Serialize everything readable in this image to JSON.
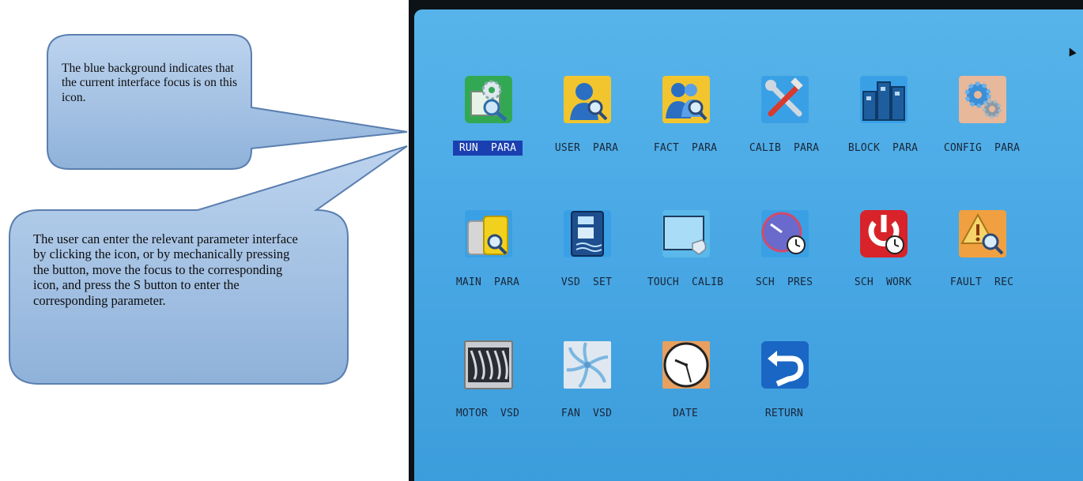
{
  "callouts": [
    {
      "text": "The blue background indicates that the current interface focus is on this icon."
    },
    {
      "text": "The user can enter the relevant parameter interface by clicking the icon, or by mechanically pressing the button, move the focus to the corresponding icon, and press the S button to enter the corresponding parameter."
    }
  ],
  "menu": {
    "focused": "RUN  PARA",
    "rows": [
      [
        {
          "label": "RUN  PARA",
          "icon": "run-para-icon"
        },
        {
          "label": "USER  PARA",
          "icon": "user-para-icon"
        },
        {
          "label": "FACT  PARA",
          "icon": "fact-para-icon"
        },
        {
          "label": "CALIB  PARA",
          "icon": "calib-para-icon"
        },
        {
          "label": "BLOCK  PARA",
          "icon": "block-para-icon"
        },
        {
          "label": "CONFIG  PARA",
          "icon": "config-para-icon"
        }
      ],
      [
        {
          "label": "MAIN  PARA",
          "icon": "main-para-icon"
        },
        {
          "label": "VSD  SET",
          "icon": "vsd-set-icon"
        },
        {
          "label": "TOUCH  CALIB",
          "icon": "touch-calib-icon"
        },
        {
          "label": "SCH  PRES",
          "icon": "sch-pres-icon"
        },
        {
          "label": "SCH  WORK",
          "icon": "sch-work-icon"
        },
        {
          "label": "FAULT  REC",
          "icon": "fault-rec-icon"
        }
      ],
      [
        {
          "label": "MOTOR  VSD",
          "icon": "motor-vsd-icon"
        },
        {
          "label": "FAN  VSD",
          "icon": "fan-vsd-icon"
        },
        {
          "label": "DATE",
          "icon": "date-icon"
        },
        {
          "label": "RETURN",
          "icon": "return-icon"
        }
      ]
    ]
  },
  "colors": {
    "screen_bg": "#4aa9e5",
    "focus_bg": "#1a3fb0",
    "callout_fill": "#9dbde0"
  }
}
